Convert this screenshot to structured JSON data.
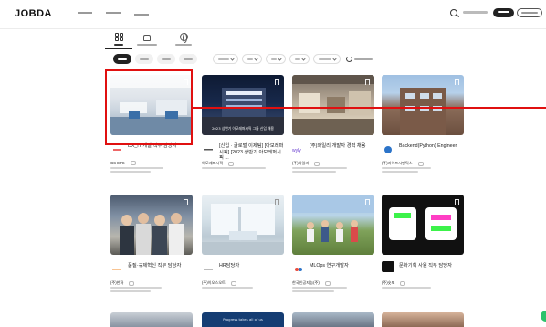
{
  "header": {
    "logo": "JOBDA",
    "nav": [
      {
        "label": ""
      },
      {
        "label": ""
      },
      {
        "label": "",
        "badge": ""
      }
    ],
    "account_label": "",
    "login_label": "",
    "signup_label": ""
  },
  "categories": [
    {
      "label": "",
      "icon": "grid-icon",
      "active": true
    },
    {
      "label": "",
      "icon": "thumb-up-icon",
      "active": false
    },
    {
      "label": "",
      "icon": "globe-icon",
      "active": false
    }
  ],
  "filters": {
    "chips": [
      {
        "label": "",
        "active": true
      },
      {
        "label": "",
        "active": false
      },
      {
        "label": "",
        "active": false
      },
      {
        "label": "",
        "active": false
      }
    ],
    "dropdowns": [
      {
        "label": ""
      },
      {
        "label": ""
      },
      {
        "label": ""
      },
      {
        "label": ""
      },
      {
        "label": ""
      }
    ],
    "reset_label": ""
  },
  "cards": [
    {
      "image_caption": "",
      "title": "DX_IT 개발 직무 담당자",
      "company": "GS EPS",
      "like": ""
    },
    {
      "image_caption": "2023 상반기 아모레퍼시픽 그룹 신입 채용",
      "title": "[신입 · 글로벌 이제팀] [아모레퍼시픽] [2023 상반기 아모레퍼시픽 ...",
      "company": "아모레퍼시픽",
      "like": ""
    },
    {
      "image_caption": "",
      "title": "(주)와일리 개발자 경력 채용",
      "company": "(주)와일리",
      "like": ""
    },
    {
      "image_caption": "",
      "title": "Backend(Python) Engineer",
      "company": "(주)라이프시맨틱스",
      "like": ""
    },
    {
      "image_caption": "",
      "title": "품질·규제혁신 직무 담당자",
      "company": "(주)한화",
      "like": ""
    },
    {
      "image_caption": "",
      "title": "HR담당자",
      "company": "(주)이오스오트",
      "like": ""
    },
    {
      "image_caption": "",
      "title": "MLOps 연구개발자",
      "company": "한국인공지능(주)",
      "like": ""
    },
    {
      "image_caption": "",
      "title": "문화기획 사원 직무 담당자",
      "company": "(주)숏또",
      "like": ""
    }
  ],
  "row3": {
    "caption": "Progress takes all of us"
  }
}
